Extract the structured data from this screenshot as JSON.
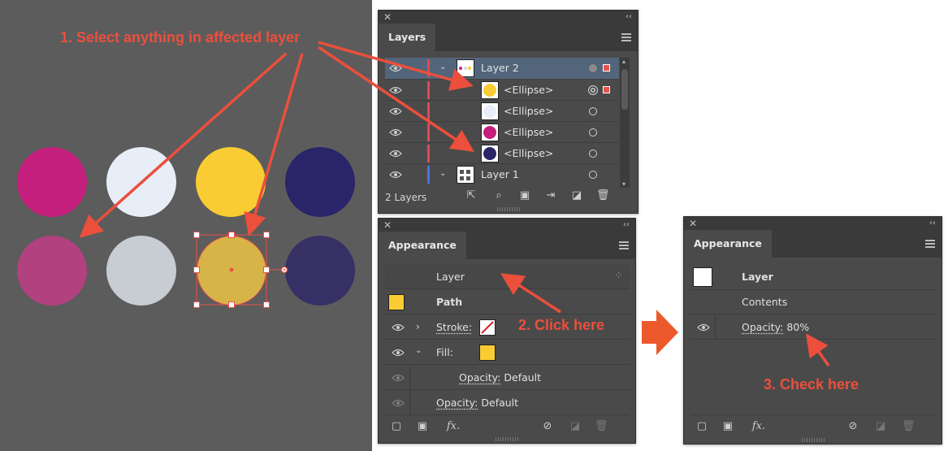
{
  "colors": {
    "pink": "#c41f7c",
    "pink_faded": "#b2417f",
    "light_blue": "#e7eef8",
    "light_gray": "#c8ccd3",
    "yellow": "#f9cc33",
    "yellow_faded": "#d7b447",
    "navy": "#2a2468",
    "navy_faded": "#363065",
    "annotation_red": "#ec4f3c",
    "selection_red": "#e8514a",
    "layer2_color": "#e04a53",
    "layer1_color": "#4c74e0"
  },
  "annotations": {
    "step1": "1. Select anything in affected layer",
    "step2": "2. Click here",
    "step3": "3. Check here"
  },
  "layers_panel": {
    "tab": "Layers",
    "rows": [
      {
        "name": "Layer 2",
        "type": "layer",
        "selected": true
      },
      {
        "name": "<Ellipse>",
        "type": "ellipse",
        "swatch": "yellow"
      },
      {
        "name": "<Ellipse>",
        "type": "ellipse",
        "swatch": "light_blue"
      },
      {
        "name": "<Ellipse>",
        "type": "ellipse",
        "swatch": "pink"
      },
      {
        "name": "<Ellipse>",
        "type": "ellipse",
        "swatch": "navy"
      },
      {
        "name": "Layer 1",
        "type": "layer"
      }
    ],
    "footer": {
      "count": "2 Layers",
      "icons": [
        "export-icon",
        "locate-object-icon",
        "make-clipping-mask-icon",
        "new-sublayer-icon",
        "new-layer-icon",
        "delete-icon"
      ]
    }
  },
  "appearance_left": {
    "tab": "Appearance",
    "layer_label": "Layer",
    "path_label": "Path",
    "stroke_label": "Stroke:",
    "fill_label": "Fill:",
    "fill_opacity_label": "Opacity:",
    "fill_opacity_value": "Default",
    "opacity_label": "Opacity:",
    "opacity_value": "Default",
    "footer_icons": [
      "add-stroke-icon",
      "add-fill-icon",
      "fx-icon",
      "clear-appearance-icon",
      "duplicate-item-icon",
      "delete-item-icon"
    ],
    "fx": "fx."
  },
  "appearance_right": {
    "tab": "Appearance",
    "layer_label": "Layer",
    "contents_label": "Contents",
    "opacity_label": "Opacity:",
    "opacity_value": "80%",
    "fx": "fx."
  }
}
